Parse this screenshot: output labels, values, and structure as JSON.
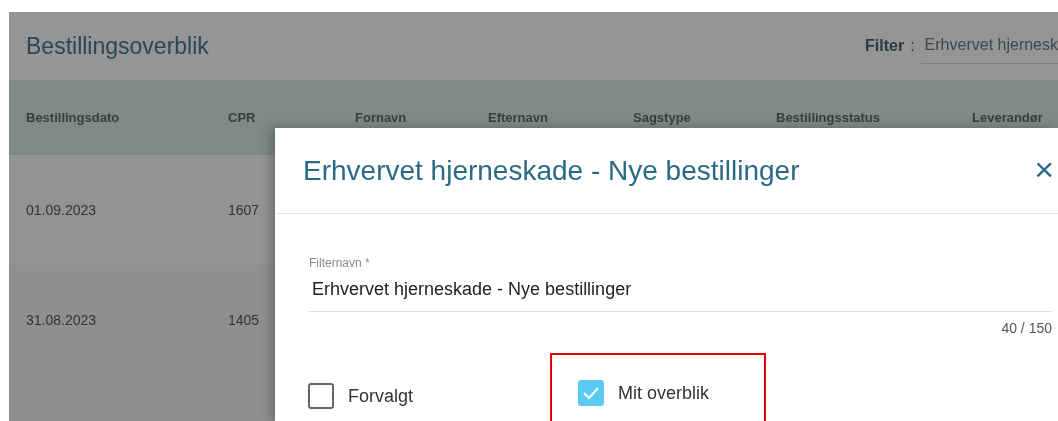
{
  "page": {
    "title": "Bestillingsoverblik",
    "filter_label": "Filter",
    "filter_separator": ":",
    "filter_value": "Erhvervet hjernesk"
  },
  "table": {
    "columns": [
      "Bestillingsdato",
      "CPR",
      "Fornavn",
      "Efternavn",
      "Sagstype",
      "Bestillingsstatus",
      "Leverandør"
    ],
    "rows": [
      [
        "01.09.2023",
        "1607"
      ],
      [
        "31.08.2023",
        "1405"
      ]
    ]
  },
  "dialog": {
    "title": "Erhvervet hjerneskade - Nye bestillinger",
    "close": "×",
    "field": {
      "label": "Filternavn",
      "required_mark": "*",
      "value": "Erhvervet hjerneskade - Nye bestillinger",
      "counter": "40 / 150"
    },
    "options": [
      {
        "label": "Forvalgt",
        "checked": false,
        "highlighted": false
      },
      {
        "label": "Mit overblik",
        "checked": true,
        "highlighted": true
      }
    ]
  }
}
